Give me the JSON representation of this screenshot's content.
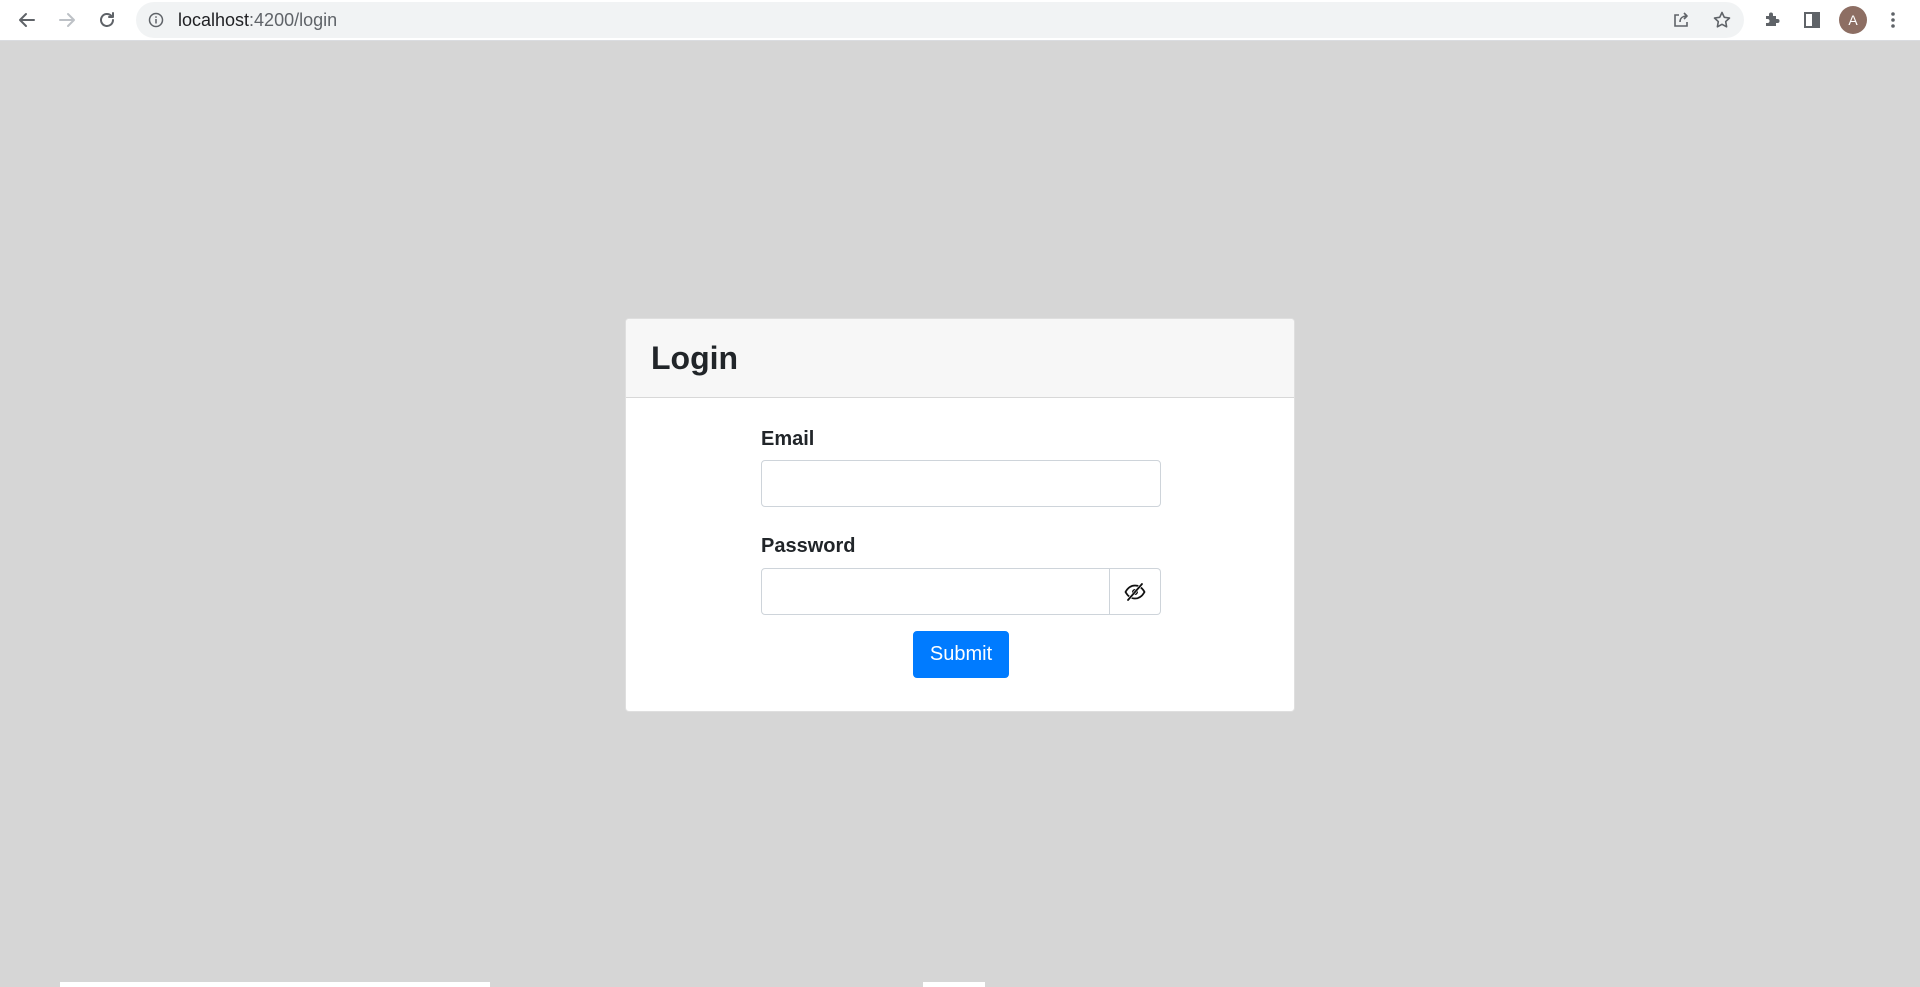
{
  "browser": {
    "url_host": "localhost",
    "url_path": ":4200/login",
    "avatar_letter": "A",
    "icons": {
      "back": "arrow-left-icon",
      "forward": "arrow-right-icon",
      "reload": "reload-icon",
      "site_info": "info-icon",
      "share": "share-icon",
      "bookmark": "star-icon",
      "extensions": "puzzle-icon",
      "side_panel": "side-panel-icon",
      "menu": "kebab-menu-icon"
    }
  },
  "login": {
    "title": "Login",
    "email_label": "Email",
    "email_value": "",
    "password_label": "Password",
    "password_value": "",
    "toggle_icon": "eye-slash-icon",
    "submit_label": "Submit"
  },
  "colors": {
    "page_background": "#d6d6d6",
    "primary": "#007bff",
    "card_header": "#f7f7f7",
    "avatar": "#8d6e63"
  }
}
